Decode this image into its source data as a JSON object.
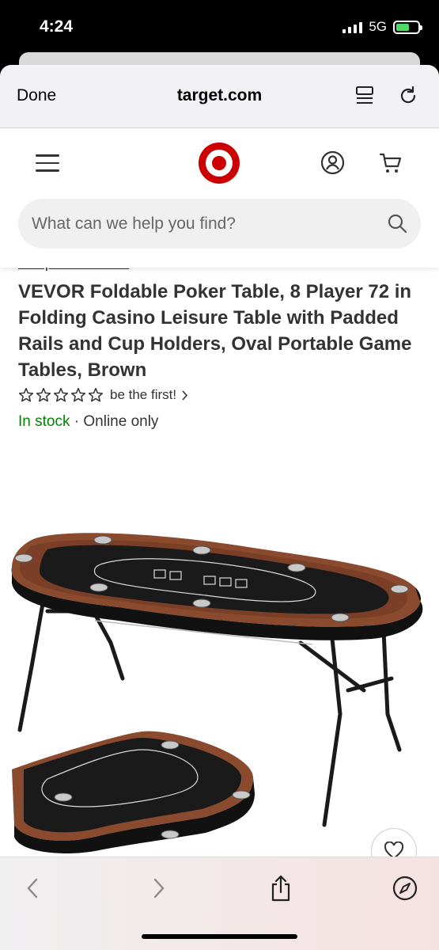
{
  "status_bar": {
    "time": "4:24",
    "network": "5G",
    "battery_level": 0.6
  },
  "browser": {
    "done_label": "Done",
    "url": "target.com"
  },
  "site_nav": {
    "search_placeholder": "What can we help you find?",
    "brand_color": "#cc0000"
  },
  "product": {
    "shop_all_link": "Shop all VEVOR",
    "title": "VEVOR Foldable Poker Table, 8 Player 72 in Folding Casino Leisure Table with Padded Rails and Cup Holders, Oval Portable Game Tables, Brown",
    "rating": {
      "stars_filled": 0,
      "stars_total": 5,
      "text": "be the first!"
    },
    "availability": {
      "in_stock": "In stock",
      "separator": " · ",
      "channel": "Online only"
    }
  },
  "colors": {
    "in_stock_green": "#008300",
    "felt": "#1a1a1a",
    "rail_brown": "#8a4a2e"
  }
}
